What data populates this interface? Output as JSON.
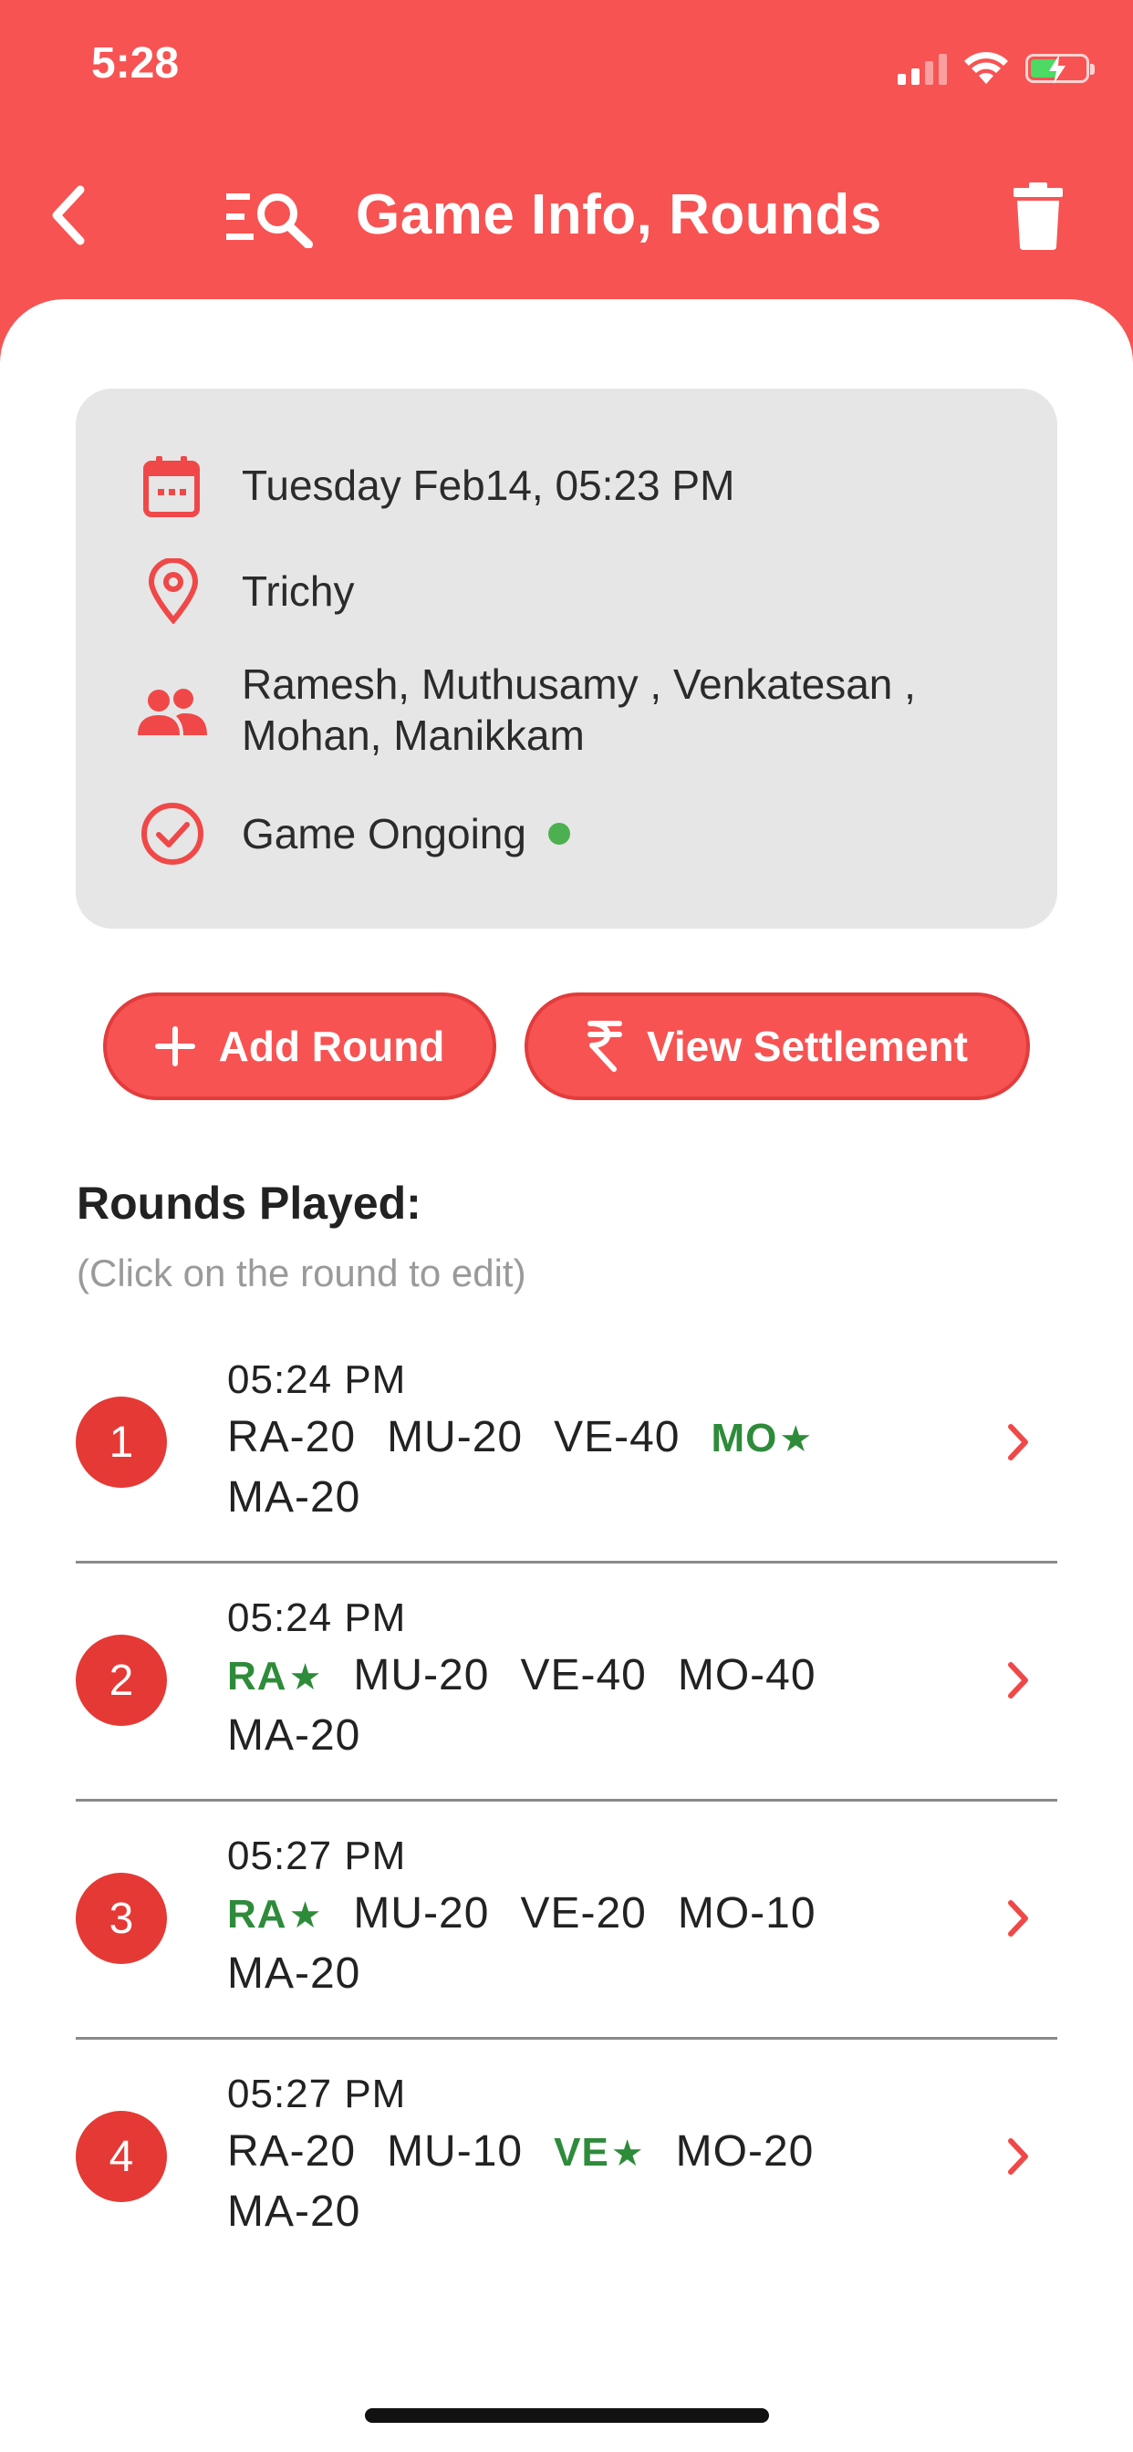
{
  "status_bar": {
    "time": "5:28"
  },
  "header": {
    "title": "Game Info, Rounds"
  },
  "game_info": {
    "datetime": "Tuesday Feb14, 05:23 PM",
    "location": "Trichy",
    "players_line1": "Ramesh, Muthusamy , Venkatesan ,",
    "players_line2": "Mohan, Manikkam",
    "status": "Game Ongoing"
  },
  "actions": {
    "add_round": "Add Round",
    "view_settlement": "View Settlement"
  },
  "rounds_section": {
    "title": "Rounds Played:",
    "hint": "(Click on the round to edit)"
  },
  "rounds": [
    {
      "number": "1",
      "time": "05:24 PM",
      "scores": [
        {
          "label": "RA-20",
          "winner": false
        },
        {
          "label": "MU-20",
          "winner": false
        },
        {
          "label": "VE-40",
          "winner": false
        },
        {
          "label": "MO",
          "winner": true
        },
        {
          "label": "MA-20",
          "winner": false
        }
      ]
    },
    {
      "number": "2",
      "time": "05:24 PM",
      "scores": [
        {
          "label": "RA",
          "winner": true
        },
        {
          "label": "MU-20",
          "winner": false
        },
        {
          "label": "VE-40",
          "winner": false
        },
        {
          "label": "MO-40",
          "winner": false
        },
        {
          "label": "MA-20",
          "winner": false
        }
      ]
    },
    {
      "number": "3",
      "time": "05:27 PM",
      "scores": [
        {
          "label": "RA",
          "winner": true
        },
        {
          "label": "MU-20",
          "winner": false
        },
        {
          "label": "VE-20",
          "winner": false
        },
        {
          "label": "MO-10",
          "winner": false
        },
        {
          "label": "MA-20",
          "winner": false
        }
      ]
    },
    {
      "number": "4",
      "time": "05:27 PM",
      "scores": [
        {
          "label": "RA-20",
          "winner": false
        },
        {
          "label": "MU-10",
          "winner": false
        },
        {
          "label": "VE",
          "winner": true
        },
        {
          "label": "MO-20",
          "winner": false
        },
        {
          "label": "MA-20",
          "winner": false
        }
      ]
    }
  ],
  "colors": {
    "primary": "#f75352",
    "winner": "#2e8b3a",
    "status_online": "#4caf50",
    "card_bg": "#e6e6e6"
  },
  "icons": [
    "back-icon",
    "search-list-icon",
    "trash-icon",
    "calendar-icon",
    "location-pin-icon",
    "people-icon",
    "check-circle-icon",
    "plus-icon",
    "rupee-icon",
    "chevron-right-icon"
  ]
}
